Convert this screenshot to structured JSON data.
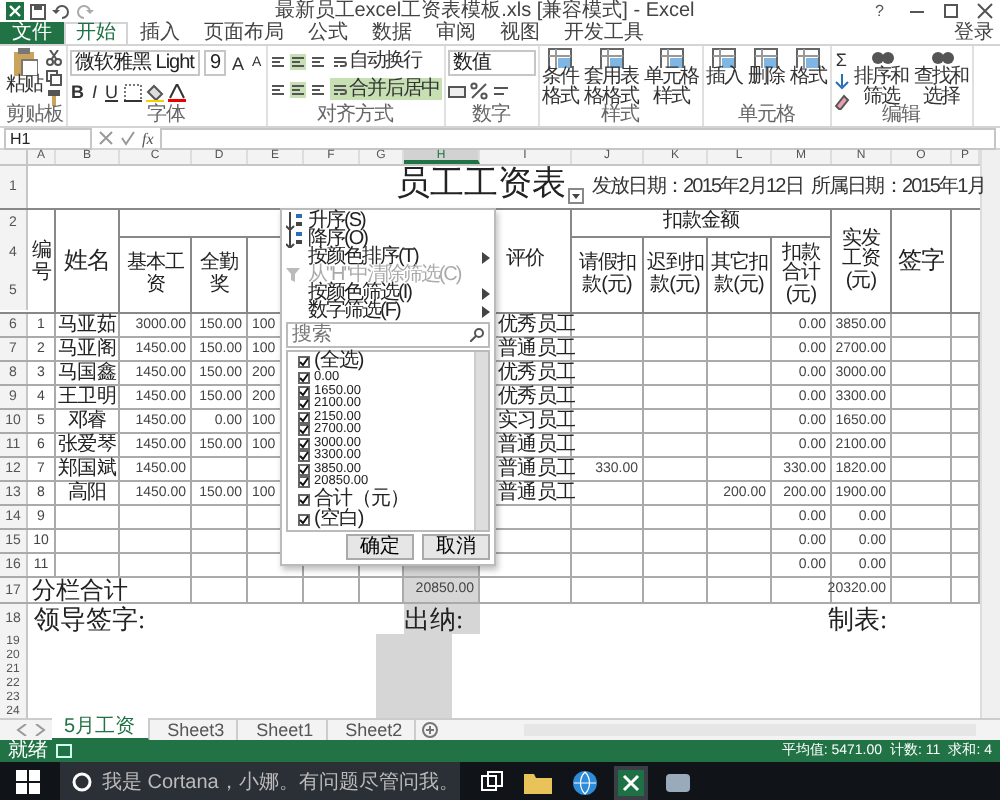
{
  "window": {
    "title": "最新员工excel工资表模板.xls [兼容模式] - Excel",
    "help": "?"
  },
  "ribbon_tabs": [
    {
      "label": "文件",
      "kind": "file",
      "selected": false
    },
    {
      "label": "开始",
      "kind": "tab",
      "selected": true
    },
    {
      "label": "插入",
      "kind": "tab",
      "selected": false
    },
    {
      "label": "页面布局",
      "kind": "tab",
      "selected": false
    },
    {
      "label": "公式",
      "kind": "tab",
      "selected": false
    },
    {
      "label": "数据",
      "kind": "tab",
      "selected": false
    },
    {
      "label": "审阅",
      "kind": "tab",
      "selected": false
    },
    {
      "label": "视图",
      "kind": "tab",
      "selected": false
    },
    {
      "label": "开发工具",
      "kind": "tab",
      "selected": false
    }
  ],
  "account": "登录",
  "ribbon_groups": [
    {
      "label": "剪贴板",
      "kind": "clipboard",
      "buttons": [
        {
          "label": "粘贴",
          "on": false
        }
      ]
    },
    {
      "label": "字体",
      "kind": "font",
      "font": "微软雅黑 Light",
      "size": "9",
      "grow": [
        "A",
        "A"
      ],
      "styles": [
        "B",
        "I",
        "U"
      ]
    },
    {
      "label": "对齐方式",
      "kind": "align",
      "buttons": [
        {
          "label": "自动换行",
          "on": false
        },
        {
          "label": "合并后居中",
          "on": true
        }
      ]
    },
    {
      "label": "数字",
      "kind": "number",
      "format": "数值"
    },
    {
      "label": "样式",
      "kind": "big",
      "buttons": [
        {
          "label": "条件格式",
          "on": false
        },
        {
          "label": "套用表格格式",
          "on": false
        },
        {
          "label": "单元格样式",
          "on": false
        }
      ]
    },
    {
      "label": "单元格",
      "kind": "big",
      "buttons": [
        {
          "label": "插入",
          "on": false
        },
        {
          "label": "删除",
          "on": false
        },
        {
          "label": "格式",
          "on": false
        }
      ]
    },
    {
      "label": "编辑",
      "kind": "edit",
      "sum": "Σ",
      "buttons": [
        {
          "label": "排序和筛选",
          "on": false
        },
        {
          "label": "查找和选择",
          "on": false
        }
      ]
    }
  ],
  "formula_bar": {
    "name_box": "H1",
    "fx": "fx"
  },
  "columns": [
    {
      "label": "A",
      "selected": false
    },
    {
      "label": "B",
      "selected": false
    },
    {
      "label": "C",
      "selected": false
    },
    {
      "label": "D",
      "selected": false
    },
    {
      "label": "E",
      "selected": false
    },
    {
      "label": "F",
      "selected": false
    },
    {
      "label": "G",
      "selected": false
    },
    {
      "label": "H",
      "selected": true
    },
    {
      "label": "I",
      "selected": false
    },
    {
      "label": "J",
      "selected": false
    },
    {
      "label": "K",
      "selected": false
    },
    {
      "label": "L",
      "selected": false
    },
    {
      "label": "M",
      "selected": false
    },
    {
      "label": "N",
      "selected": false
    },
    {
      "label": "O",
      "selected": false
    },
    {
      "label": "P",
      "selected": false
    }
  ],
  "row_labels": [
    "1",
    "2",
    "4",
    "5",
    "6",
    "7",
    "8",
    "9",
    "10",
    "11",
    "12",
    "13",
    "14",
    "15",
    "16",
    "17",
    "18",
    "19",
    "20",
    "21",
    "22",
    "23",
    "24"
  ],
  "sheet": {
    "title": "员工工资表",
    "issue_date": "发放日期：2015年2月12日",
    "period": "所属日期：2015年1月",
    "headers": {
      "no": "编号",
      "name": "姓名",
      "base": "基本工资",
      "attend": "全勤奖",
      "rating": "评价",
      "deduction": "扣款金额",
      "leave": "请假扣款(元)",
      "late": "迟到扣款(元)",
      "other": "其它扣款(元)",
      "deduct": "扣款合计(元)",
      "net": "实发工资(元)",
      "sign": "签字"
    },
    "rows": [
      {
        "no": "1",
        "name": "马亚茹",
        "base": "3000.00",
        "attend": "150.00",
        "bonus": "100",
        "rating": "优秀员工",
        "deduct": "0.00",
        "net": "3850.00"
      },
      {
        "no": "2",
        "name": "马亚阁",
        "base": "1450.00",
        "attend": "150.00",
        "bonus": "100",
        "rating": "普通员工",
        "deduct": "0.00",
        "net": "2700.00"
      },
      {
        "no": "3",
        "name": "马国鑫",
        "base": "1450.00",
        "attend": "150.00",
        "bonus": "200",
        "rating": "优秀员工",
        "deduct": "0.00",
        "net": "3000.00"
      },
      {
        "no": "4",
        "name": "王卫明",
        "base": "1450.00",
        "attend": "150.00",
        "bonus": "200",
        "rating": "优秀员工",
        "deduct": "0.00",
        "net": "3300.00"
      },
      {
        "no": "5",
        "name": "邓睿",
        "base": "1450.00",
        "attend": "0.00",
        "bonus": "100",
        "rating": "实习员工",
        "deduct": "0.00",
        "net": "1650.00"
      },
      {
        "no": "6",
        "name": "张爱琴",
        "base": "1450.00",
        "attend": "150.00",
        "bonus": "100",
        "rating": "普通员工",
        "deduct": "0.00",
        "net": "2100.00"
      },
      {
        "no": "7",
        "name": "郑国斌",
        "base": "1450.00",
        "rating": "普通员工",
        "leave": "330.00",
        "deduct": "330.00",
        "net": "1820.00"
      },
      {
        "no": "8",
        "name": "高阳",
        "base": "1450.00",
        "attend": "150.00",
        "bonus": "100",
        "rating": "普通员工",
        "other": "200.00",
        "deduct": "200.00",
        "net": "1900.00"
      },
      {
        "no": "9",
        "deduct": "0.00",
        "net": "0.00"
      },
      {
        "no": "10",
        "deduct": "0.00",
        "net": "0.00"
      },
      {
        "no": "11",
        "deduct": "0.00",
        "net": "0.00"
      }
    ],
    "total": {
      "label": "分栏合计",
      "column_h": "20850.00",
      "net": "20320.00"
    },
    "signatures": [
      "领导签字:",
      "出纳:",
      "制表:"
    ]
  },
  "filter_menu": {
    "items": [
      {
        "label": "升序(S)",
        "kind": "sort",
        "disabled": false
      },
      {
        "label": "降序(O)",
        "kind": "sort",
        "disabled": false
      },
      {
        "label": "按颜色排序(T)",
        "kind": "submenu",
        "disabled": false
      },
      {
        "label": "从\"H\"中清除筛选(C)",
        "kind": "clear",
        "disabled": true
      },
      {
        "label": "按颜色筛选(I)",
        "kind": "submenu",
        "disabled": false
      },
      {
        "label": "数字筛选(F)",
        "kind": "submenu",
        "disabled": false
      }
    ],
    "search_placeholder": "搜索",
    "values": [
      {
        "label": "(全选)",
        "kind": "text",
        "checked": true
      },
      {
        "label": "0.00",
        "kind": "number",
        "checked": true
      },
      {
        "label": "1650.00",
        "kind": "number",
        "checked": true
      },
      {
        "label": "2100.00",
        "kind": "number",
        "checked": true
      },
      {
        "label": "2150.00",
        "kind": "number",
        "checked": true
      },
      {
        "label": "2700.00",
        "kind": "number",
        "checked": true
      },
      {
        "label": "3000.00",
        "kind": "number",
        "checked": true
      },
      {
        "label": "3300.00",
        "kind": "number",
        "checked": true
      },
      {
        "label": "3850.00",
        "kind": "number",
        "checked": true
      },
      {
        "label": "20850.00",
        "kind": "number",
        "checked": true
      },
      {
        "label": "合计（元）",
        "kind": "text",
        "checked": true
      },
      {
        "label": "(空白)",
        "kind": "text",
        "checked": true
      }
    ],
    "buttons": [
      "确定",
      "取消"
    ]
  },
  "sheet_tabs": [
    {
      "label": "5月工资",
      "selected": true
    },
    {
      "label": "Sheet3",
      "selected": false
    },
    {
      "label": "Sheet1",
      "selected": false
    },
    {
      "label": "Sheet2",
      "selected": false
    }
  ],
  "status_bar": {
    "mode": "就绪",
    "stats": [
      "平均值: 5471.00",
      "计数: 11",
      "求和: 4"
    ]
  },
  "taskbar": {
    "search_placeholder": "我是 Cortana，小娜。有问题尽管问我。"
  }
}
